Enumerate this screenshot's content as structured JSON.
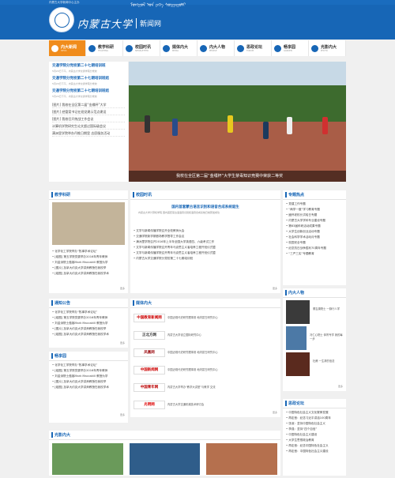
{
  "header": {
    "top_text": "内蒙古大学新闻中心主办",
    "mongolian": "ᠮᠣᠩᠭᠣᠯ ᠤᠨ ᠶᠡᠬᠡ ᠰᠤᠷᠭᠠᠭᠤᠯᠢ",
    "site_title": "内蒙古大学",
    "site_sub": "新闻网"
  },
  "nav": [
    {
      "label": "内大新闻",
      "en": "NEWS"
    },
    {
      "label": "教学科研",
      "en": "TEACHING"
    },
    {
      "label": "校园时讯",
      "en": "NEWSLETTER"
    },
    {
      "label": "媒体内大",
      "en": "MEDIA"
    },
    {
      "label": "内大人物",
      "en": "PEOPLE"
    },
    {
      "label": "思政论坛",
      "en": "FORUM"
    },
    {
      "label": "畅享园",
      "en": "GARDEN"
    },
    {
      "label": "光影内大",
      "en": "PHOTO"
    }
  ],
  "left_news": {
    "headlines": [
      {
        "title": "交通学院分党校第二十七期培训班",
        "date": "5月20日下午，内蒙古大学交通学院分党校"
      },
      {
        "title": "交通学院分党校第二十七期培训班结",
        "date": "5月20日下午，内蒙古大学交通学院分党校"
      },
      {
        "title": "交通学院分党校第二十七期培训班结",
        "date": "5月20日下午，内蒙古大学交通学院分党校"
      }
    ],
    "list": [
      "[图片] 我校在全区第二届“金缰杯”大学",
      "[图片] 经管案书记在班党建示范点建设",
      "[图片] 我校召开统战工作会议",
      "计算机学院研究生论文超过国际级会议",
      "满洲里学院举办丹推日期里 志愿服务活动"
    ]
  },
  "slide": {
    "caption": "我校在全区第二届“金缰杯”大学生禁毒知识竞赛中荣获二等奖"
  },
  "teaching": {
    "title": "教学科研",
    "items": [
      "• 化学化工学院举办“牧事学术论坛”",
      "• [组图] 第五学院党委举办2016年青年教师",
      "• 刘金深院士做客Mark Maccakill 教授为学",
      "• [图片] 加拿大约克大学讲师教授在我校举",
      "• [组图] 加拿大约克大学讲师教授在我校学术"
    ],
    "more": "更多"
  },
  "campus": {
    "title": "校园时讯",
    "lead_title": "国内首套蒙古语言识别和语音合成系统诞生",
    "lead_body": "内蒙古大学计算机学院 国内首套蒙古语语音识别和语音合成系统日前研发成功",
    "items": [
      "• 文学与新闻传播学院召开全校教师大会",
      "• 交通学院新学期首场教学督导工作会议",
      "• 满洲里学院召开2016年上半年全国大学英语四、六级考试工作",
      "• 文学与新闻传播学院召开青年马克思主义者培养工程开班仪式暨",
      "• 文学与新闻传播学院召开青年马克思主义者培养工程开班仪式暨",
      "• 内蒙古大学交通学院分党校第二十七期培训班"
    ],
    "more": "更多"
  },
  "hot": {
    "title": "专题热点",
    "items": [
      "• 党建工作专题",
      "• “两学一做”学习教育专题",
      "• 缅怀老校长洪哈日专题",
      "• 内蒙古大学学科专业建设专题",
      "• 第83届科研活动成果专题",
      "• 大学生创新创业活动专题",
      "• 社会科学学术活动月专题",
      "• 校园安全专题",
      "• 纪念抗日战争胜利70周年专题",
      "• “三严三实”专题教育"
    ]
  },
  "notice": {
    "title": "通知公告",
    "items": [
      "• 化学化工学院举办“牧事学术论坛”",
      "• [组图] 第五学院党委举办2016年青年教师",
      "• 刘金深院士做客Mark Maccakill 教授为学",
      "• [图片] 加拿大约克大学讲师教授在我校举",
      "• [组图] 加拿大约克大学讲师教授在我校学术"
    ],
    "more": "更多"
  },
  "media": {
    "title": "媒体内大",
    "items": [
      {
        "logo": "中国教育新闻网",
        "text": "中国近现代史研究理事常 地内蒙古研究中心"
      },
      {
        "logo": "正北方网",
        "text": "内蒙古大学设立国际研究中心"
      },
      {
        "logo": "凤凰网",
        "text": "中国近现代史研究理事常 地内蒙古研究中心"
      },
      {
        "logo": "中国新闻网",
        "text": "中国近现代史研究理事常 地内蒙古研究中心"
      },
      {
        "logo": "中国青年网",
        "text": "内蒙古大学举办“教学大讲堂”与教学 交流"
      },
      {
        "logo": "光明网",
        "text": "内蒙古大学交通机械技术研讨会"
      }
    ],
    "more": "更多"
  },
  "people": {
    "title": "内大人物",
    "items": [
      {
        "text": "董吉唐院士 一脉行人学"
      },
      {
        "text": "冯仁心院士 体育专学 我的每一步"
      },
      {
        "text": "杜甫 一生求的信念"
      }
    ],
    "more": "更多"
  },
  "garden": {
    "title": "畅享园",
    "items": [
      "• 化学化工学院举办“牧事学术论坛”",
      "• [组图] 第五学院党委举办2016年青年教师",
      "• 刘金深院士做客Mark Maccakill 教授为学",
      "• [图片] 加拿大约克大学讲师教授在我校举",
      "• [组图] 加拿大约克大学讲师教授在我校学术"
    ],
    "more": "更多"
  },
  "forum": {
    "title": "思政论坛",
    "items": [
      "• 中国特色社会主义文化繁荣发展",
      "• 再定音：纪念习近平讲话100周年",
      "• 张淑：坚持中国特色社会主义",
      "• 李强：坚持“四个自信”",
      "• 中国特色社会主义建设",
      "• 大学生思想政治教育",
      "• 再定音：纪念中国特色社会主义",
      "• 再定音：中国特色社会主义建设"
    ]
  },
  "photo": {
    "title": "光影内大"
  }
}
